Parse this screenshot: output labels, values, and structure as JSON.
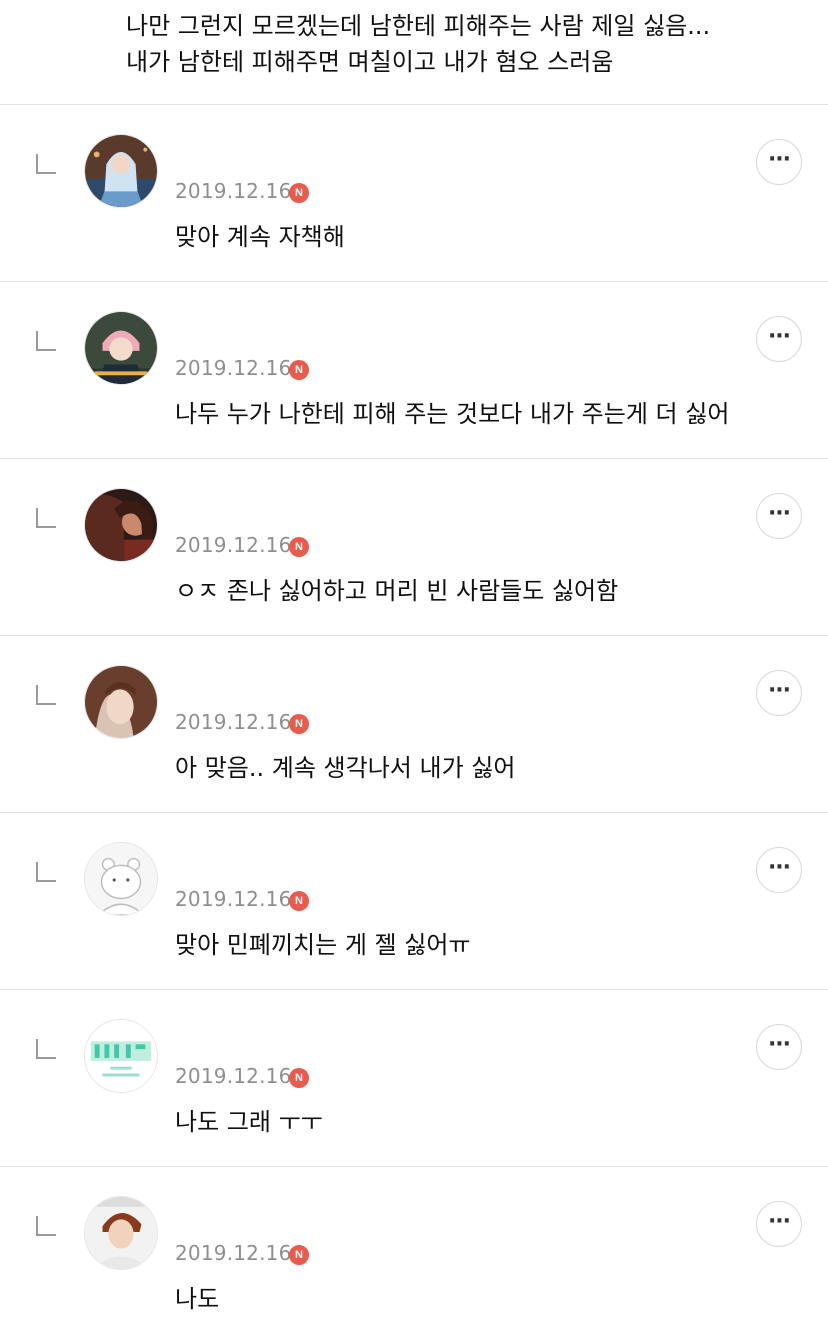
{
  "parent_comment": {
    "line1": "나만 그런지 모르겠는데 남한테 피해주는 사람 제일 싫음...",
    "line2": "내가 남한테 피해주면 며칠이고 내가 혐오 스러움"
  },
  "replies": [
    {
      "nickname": "",
      "date": "2019.12.16",
      "badge": "N",
      "text": "맞아 계속 자책해",
      "more": "···"
    },
    {
      "nickname": "",
      "date": "2019.12.16",
      "badge": "N",
      "text": "나두 누가 나한테 피해 주는 것보다 내가 주는게 더 싫어",
      "more": "···"
    },
    {
      "nickname": "",
      "date": "2019.12.16",
      "badge": "N",
      "text": "ㅇㅈ 존나 싫어하고 머리 빈 사람들도 싫어함",
      "more": "···"
    },
    {
      "nickname": "",
      "date": "2019.12.16",
      "badge": "N",
      "text": "아 맞음.. 계속 생각나서 내가 싫어",
      "more": "···"
    },
    {
      "nickname": "",
      "date": "2019.12.16",
      "badge": "N",
      "text": "맞아 민폐끼치는 게 젤 싫어ㅠ",
      "more": "···"
    },
    {
      "nickname": "",
      "date": "2019.12.16",
      "badge": "N",
      "text": "나도 그래 ㅜㅜ",
      "more": "···"
    },
    {
      "nickname": "",
      "date": "2019.12.16",
      "badge": "N",
      "text": "나도",
      "more": "···"
    }
  ],
  "colors": {
    "badge": "#ec5a4b",
    "date": "#8f8f8f",
    "divider": "#e3e3e3"
  }
}
